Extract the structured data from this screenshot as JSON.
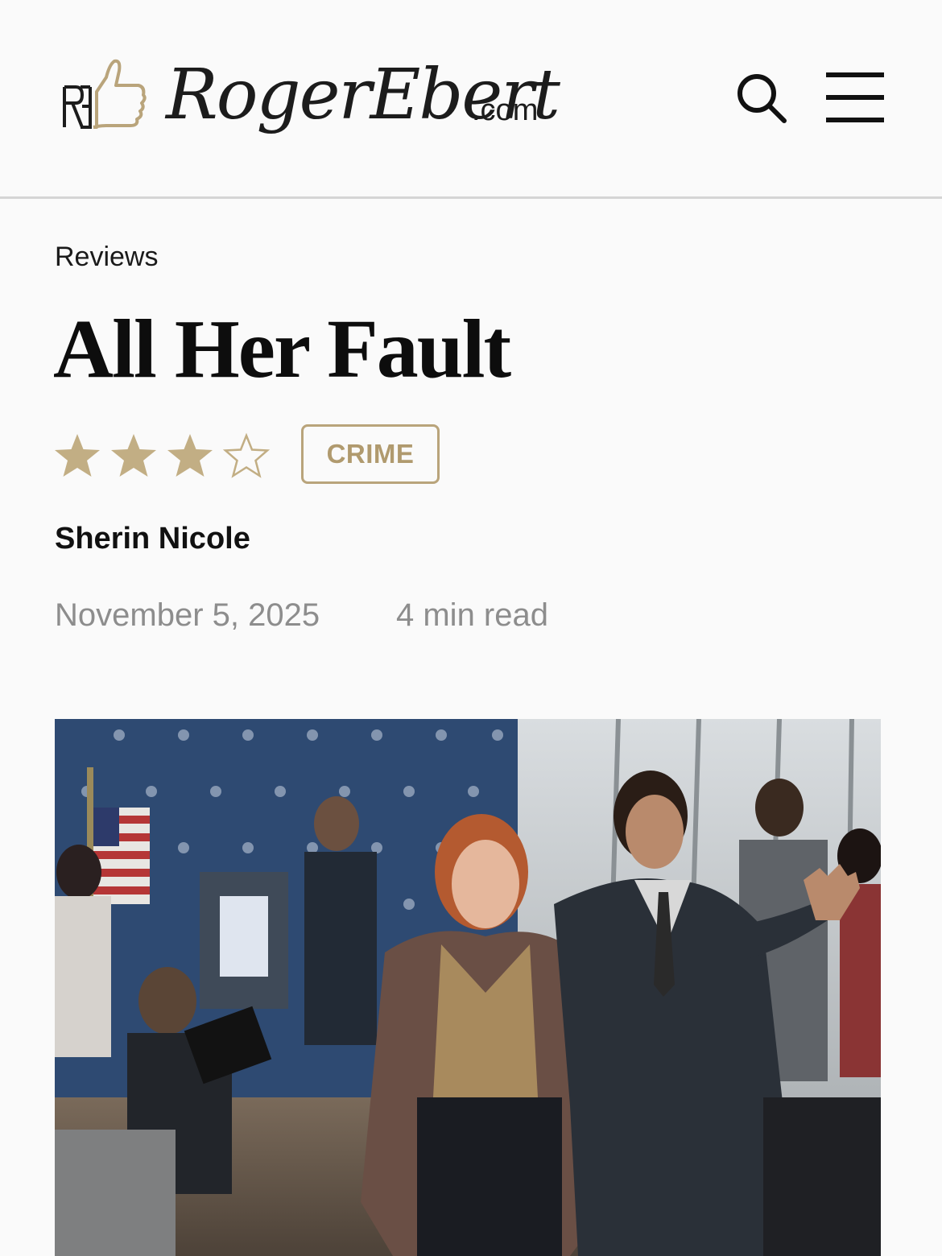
{
  "header": {
    "logo_text": "RogerEbert",
    "logo_suffix": ".com",
    "search_icon": "search-icon",
    "menu_icon": "hamburger-menu-icon"
  },
  "article": {
    "section": "Reviews",
    "title": "All Her Fault",
    "rating": 3,
    "rating_max": 4,
    "genre": "CRIME",
    "author": "Sherin Nicole",
    "date": "November 5, 2025",
    "read_time": "4 min read"
  },
  "colors": {
    "accent_gold": "#b9a47b",
    "star_fill": "#c2ae84",
    "meta_gray": "#8d8d8d"
  },
  "hero_image": {
    "description_icon": "hero-photo"
  }
}
